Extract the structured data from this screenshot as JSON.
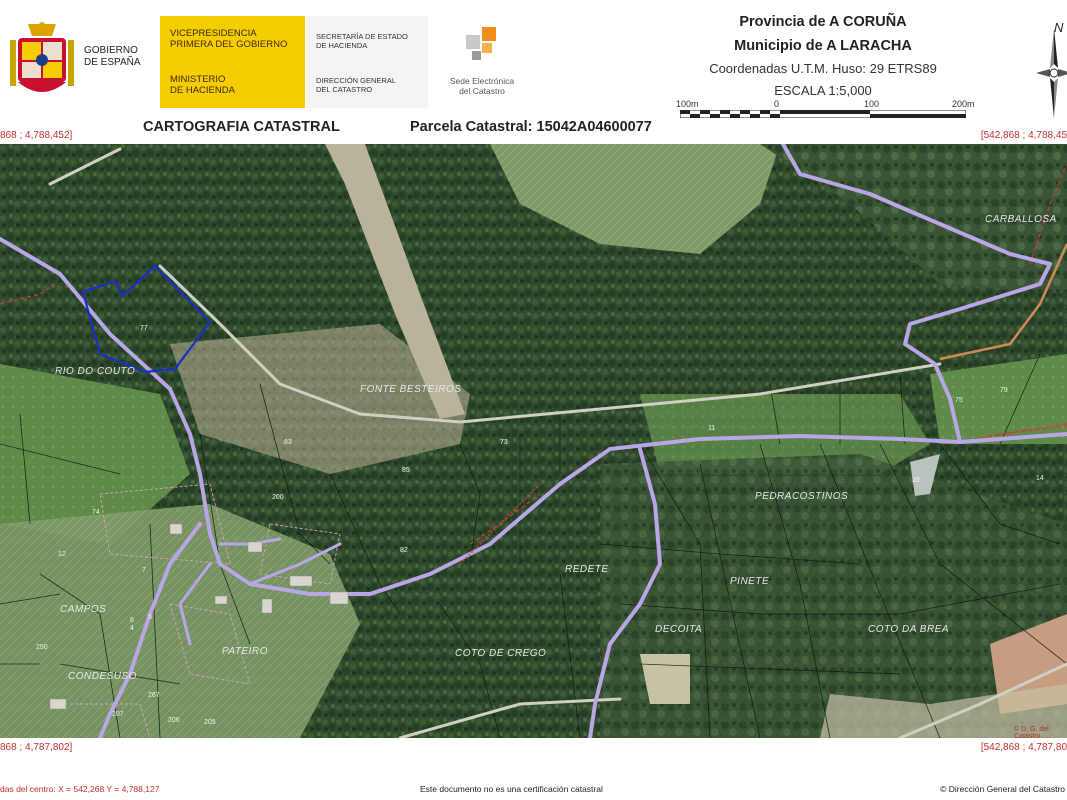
{
  "header": {
    "gov": {
      "line1": "GOBIERNO",
      "line2": "DE ESPAÑA"
    },
    "yellow": {
      "t1a": "VICEPRESIDENCIA",
      "t1b": "PRIMERA DEL GOBIERNO",
      "t2a": "MINISTERIO",
      "t2b": "DE HACIENDA"
    },
    "grey": {
      "t1a": "SECRETARÍA DE ESTADO",
      "t1b": "DE HACIENDA",
      "t2a": "DIRECCIÓN GENERAL",
      "t2b": "DEL CATASTRO"
    },
    "sede": {
      "line1": "Sede Electrónica",
      "line2": "del Catastro"
    },
    "province": "Provincia de A CORUÑA",
    "municipality": "Municipio de A LARACHA",
    "coordinates": "Coordenadas U.T.M. Huso: 29 ETRS89",
    "scale": "ESCALA 1:5,000",
    "scale_ticks": [
      "100m",
      "0",
      "100",
      "200m"
    ],
    "compass_letter": "N"
  },
  "title_bar": {
    "cartography": "CARTOGRAFIA CATASTRAL",
    "parcel": "Parcela Catastral: 15042A04600077"
  },
  "corners": {
    "top_left": "868 ; 4,788,452]",
    "top_right": "[542,868 ; 4,788,45",
    "bottom_left": "868 ; 4,787,802]",
    "bottom_right": "[542,868 ; 4,787,80"
  },
  "map": {
    "place_names": [
      "RIO DO COUTO",
      "FONTE BESTEIROS",
      "CARBALLOSA",
      "PEDRACOSTINOS",
      "REDETE",
      "PINETE",
      "DECOITA",
      "COTO DA BREA",
      "CAMPOS",
      "PATEIRO",
      "CONDESUSO",
      "COTO DE CREGO"
    ],
    "parcel_numbers": [
      "77",
      "75",
      "79",
      "85",
      "83",
      "82",
      "74",
      "12",
      "7",
      "6",
      "5",
      "4",
      "250",
      "206",
      "207",
      "205",
      "267",
      "200",
      "39",
      "14",
      "11",
      "73"
    ],
    "watermark": "© D. G. del Catastro",
    "colors": {
      "forest": "#2f4a2c",
      "road": "#b9a6e6",
      "parcel_outline": "#1a2fc9",
      "boundary": "#c03030"
    }
  },
  "footer": {
    "center_coords": "das del centro: X = 542,268 Y = 4,788,127",
    "notice": "Este documento no es una certificación catastral",
    "copyright": "© Dirección General del Catastro"
  }
}
